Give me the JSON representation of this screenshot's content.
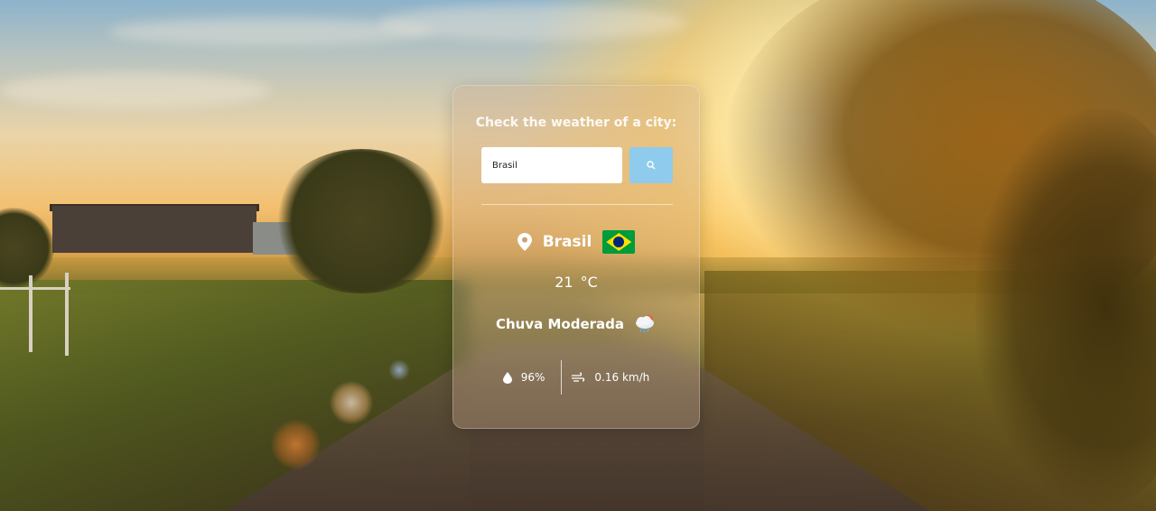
{
  "weather_card": {
    "title": "Check the weather of a city:",
    "search": {
      "value": "Brasil",
      "placeholder": ""
    },
    "search_icon": "search-icon",
    "city": "Brasil",
    "country_flag": "brazil-flag",
    "temperature": "21",
    "temperature_unit": "°C",
    "description": "Chuva Moderada",
    "weather_icon": "rain-cloud-icon",
    "humidity": "96%",
    "wind": "0.16 km/h"
  },
  "colors": {
    "search_button": "#8fcbed",
    "card_background": "rgba(200,170,140,0.35)",
    "text": "#ffffff"
  }
}
